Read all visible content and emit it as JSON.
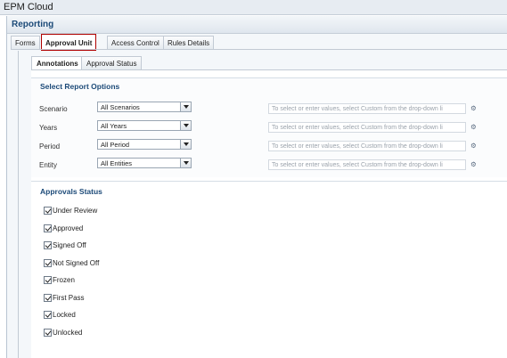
{
  "window": {
    "title": "EPM Cloud"
  },
  "panel": {
    "title": "Reporting"
  },
  "main_tabs": [
    {
      "label": "Forms",
      "active": false
    },
    {
      "label": "Approval Unit",
      "active": true
    },
    {
      "label": "Access Control",
      "active": false
    },
    {
      "label": "Rules Details",
      "active": false
    }
  ],
  "sub_tabs": [
    {
      "label": "Annotations",
      "active": true
    },
    {
      "label": "Approval Status",
      "active": false
    }
  ],
  "report_options": {
    "title": "Select Report Options",
    "rows": [
      {
        "label": "Scenario",
        "value": "All Scenarios",
        "hint": "To select or enter values, select Custom from the drop-down li"
      },
      {
        "label": "Years",
        "value": "All Years",
        "hint": "To select or enter values, select Custom from the drop-down li"
      },
      {
        "label": "Period",
        "value": "All Period",
        "hint": "To select or enter values, select Custom from the drop-down li"
      },
      {
        "label": "Entity",
        "value": "All Entities",
        "hint": "To select or enter values, select Custom from the drop-down li"
      }
    ],
    "hint_icon": "member-selector-icon"
  },
  "approvals_status": {
    "title": "Approvals Status",
    "items": [
      {
        "label": "Under Review",
        "checked": true
      },
      {
        "label": "Approved",
        "checked": true
      },
      {
        "label": "Signed Off",
        "checked": true
      },
      {
        "label": "Not Signed Off",
        "checked": true
      },
      {
        "label": "Frozen",
        "checked": true
      },
      {
        "label": "First Pass",
        "checked": true
      },
      {
        "label": "Locked",
        "checked": true
      },
      {
        "label": "Unlocked",
        "checked": true
      }
    ]
  }
}
